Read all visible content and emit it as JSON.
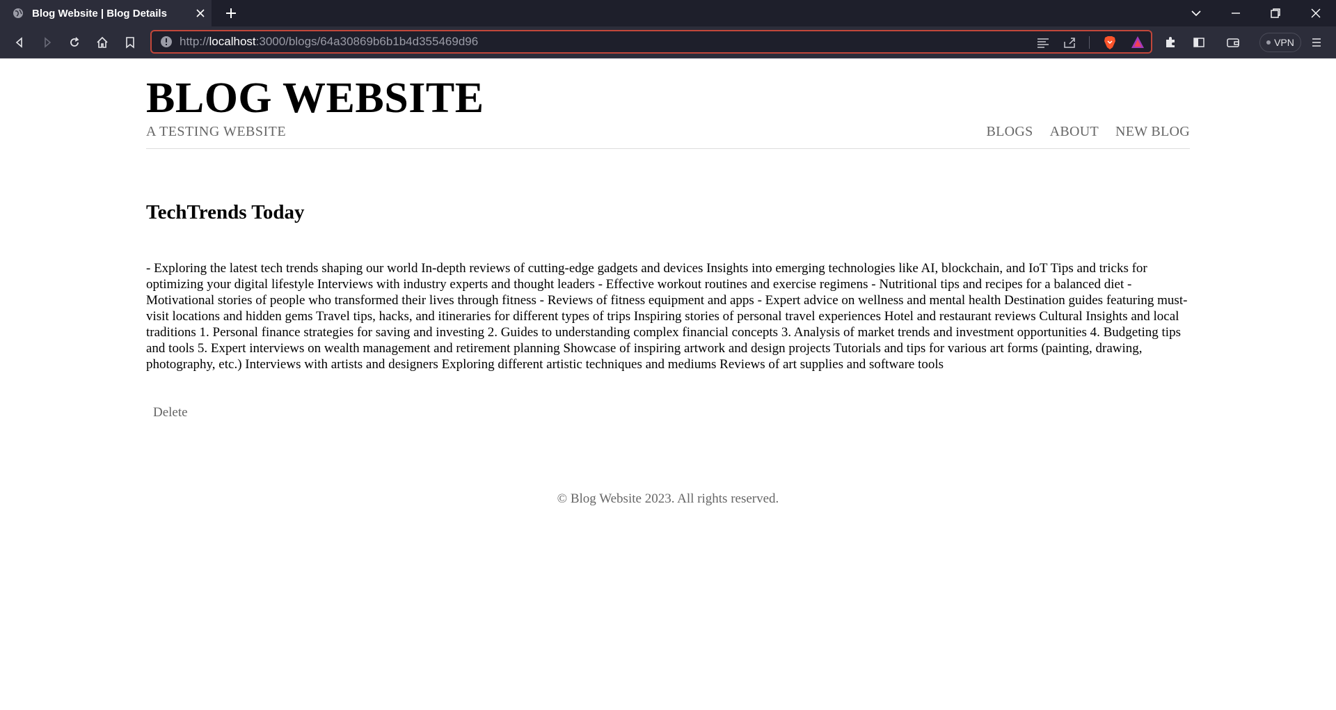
{
  "browser": {
    "tab_title": "Blog Website | Blog Details",
    "url_scheme": "http://",
    "url_host": "localhost",
    "url_rest": ":3000/blogs/64a30869b6b1b4d355469d96",
    "vpn_label": "VPN",
    "accent_color": "#c2473a"
  },
  "header": {
    "site_title": "BLOG WEBSITE",
    "tagline": "A TESTING WEBSITE",
    "nav": [
      "BLOGS",
      "ABOUT",
      "NEW BLOG"
    ]
  },
  "post": {
    "title": "TechTrends Today",
    "body": "- Exploring the latest tech trends shaping our world In-depth reviews of cutting-edge gadgets and devices Insights into emerging technologies like AI, blockchain, and IoT Tips and tricks for optimizing your digital lifestyle Interviews with industry experts and thought leaders - Effective workout routines and exercise regimens - Nutritional tips and recipes for a balanced diet - Motivational stories of people who transformed their lives through fitness - Reviews of fitness equipment and apps - Expert advice on wellness and mental health Destination guides featuring must-visit locations and hidden gems Travel tips, hacks, and itineraries for different types of trips Inspiring stories of personal travel experiences Hotel and restaurant reviews Cultural Insights and local traditions 1. Personal finance strategies for saving and investing 2. Guides to understanding complex financial concepts 3. Analysis of market trends and investment opportunities 4. Budgeting tips and tools 5. Expert interviews on wealth management and retirement planning Showcase of inspiring artwork and design projects Tutorials and tips for various art forms (painting, drawing, photography, etc.) Interviews with artists and designers Exploring different artistic techniques and mediums Reviews of art supplies and software tools",
    "delete_label": "Delete"
  },
  "footer": {
    "text": "© Blog Website 2023. All rights reserved."
  }
}
